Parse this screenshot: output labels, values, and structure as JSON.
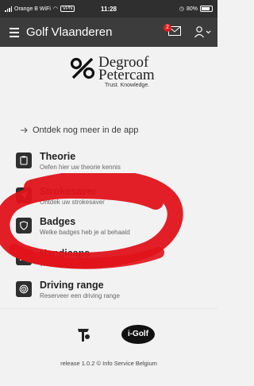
{
  "status_bar": {
    "carrier": "Orange B WiFi",
    "vpn": "VPN",
    "time": "11:28",
    "battery": "80%"
  },
  "app_bar": {
    "title": "Golf Vlaanderen",
    "notification_count": "2"
  },
  "brand": {
    "logo_line1": "Degroof",
    "logo_line2": "Petercam",
    "tagline": "Trust. Knowledge."
  },
  "discover_text": "Ontdek nog meer in de app",
  "menu": [
    {
      "title": "Theorie",
      "subtitle": "Oefen hier uw theorie kennis",
      "icon": "clipboard-icon"
    },
    {
      "title": "Strokesaver",
      "subtitle": "Ontdek uw strokesaver",
      "icon": "location-arrow-icon"
    },
    {
      "title": "Badges",
      "subtitle": "Welke badges heb je al behaald",
      "icon": "shield-icon"
    },
    {
      "title": "Handicaps",
      "subtitle": "Wat is mijn handicap?",
      "icon": "list-icon"
    },
    {
      "title": "Driving range",
      "subtitle": "Reserveer een driving range",
      "icon": "target-icon"
    }
  ],
  "footer": {
    "release": "release 1.0.2 © Info Service Belgium",
    "igolf_label": "i-Golf"
  },
  "colors": {
    "app_bar": "#3c3c3c",
    "status_bar": "#2f2f2f",
    "annotation_red": "#e0131a",
    "badge": "#e01e1e"
  }
}
